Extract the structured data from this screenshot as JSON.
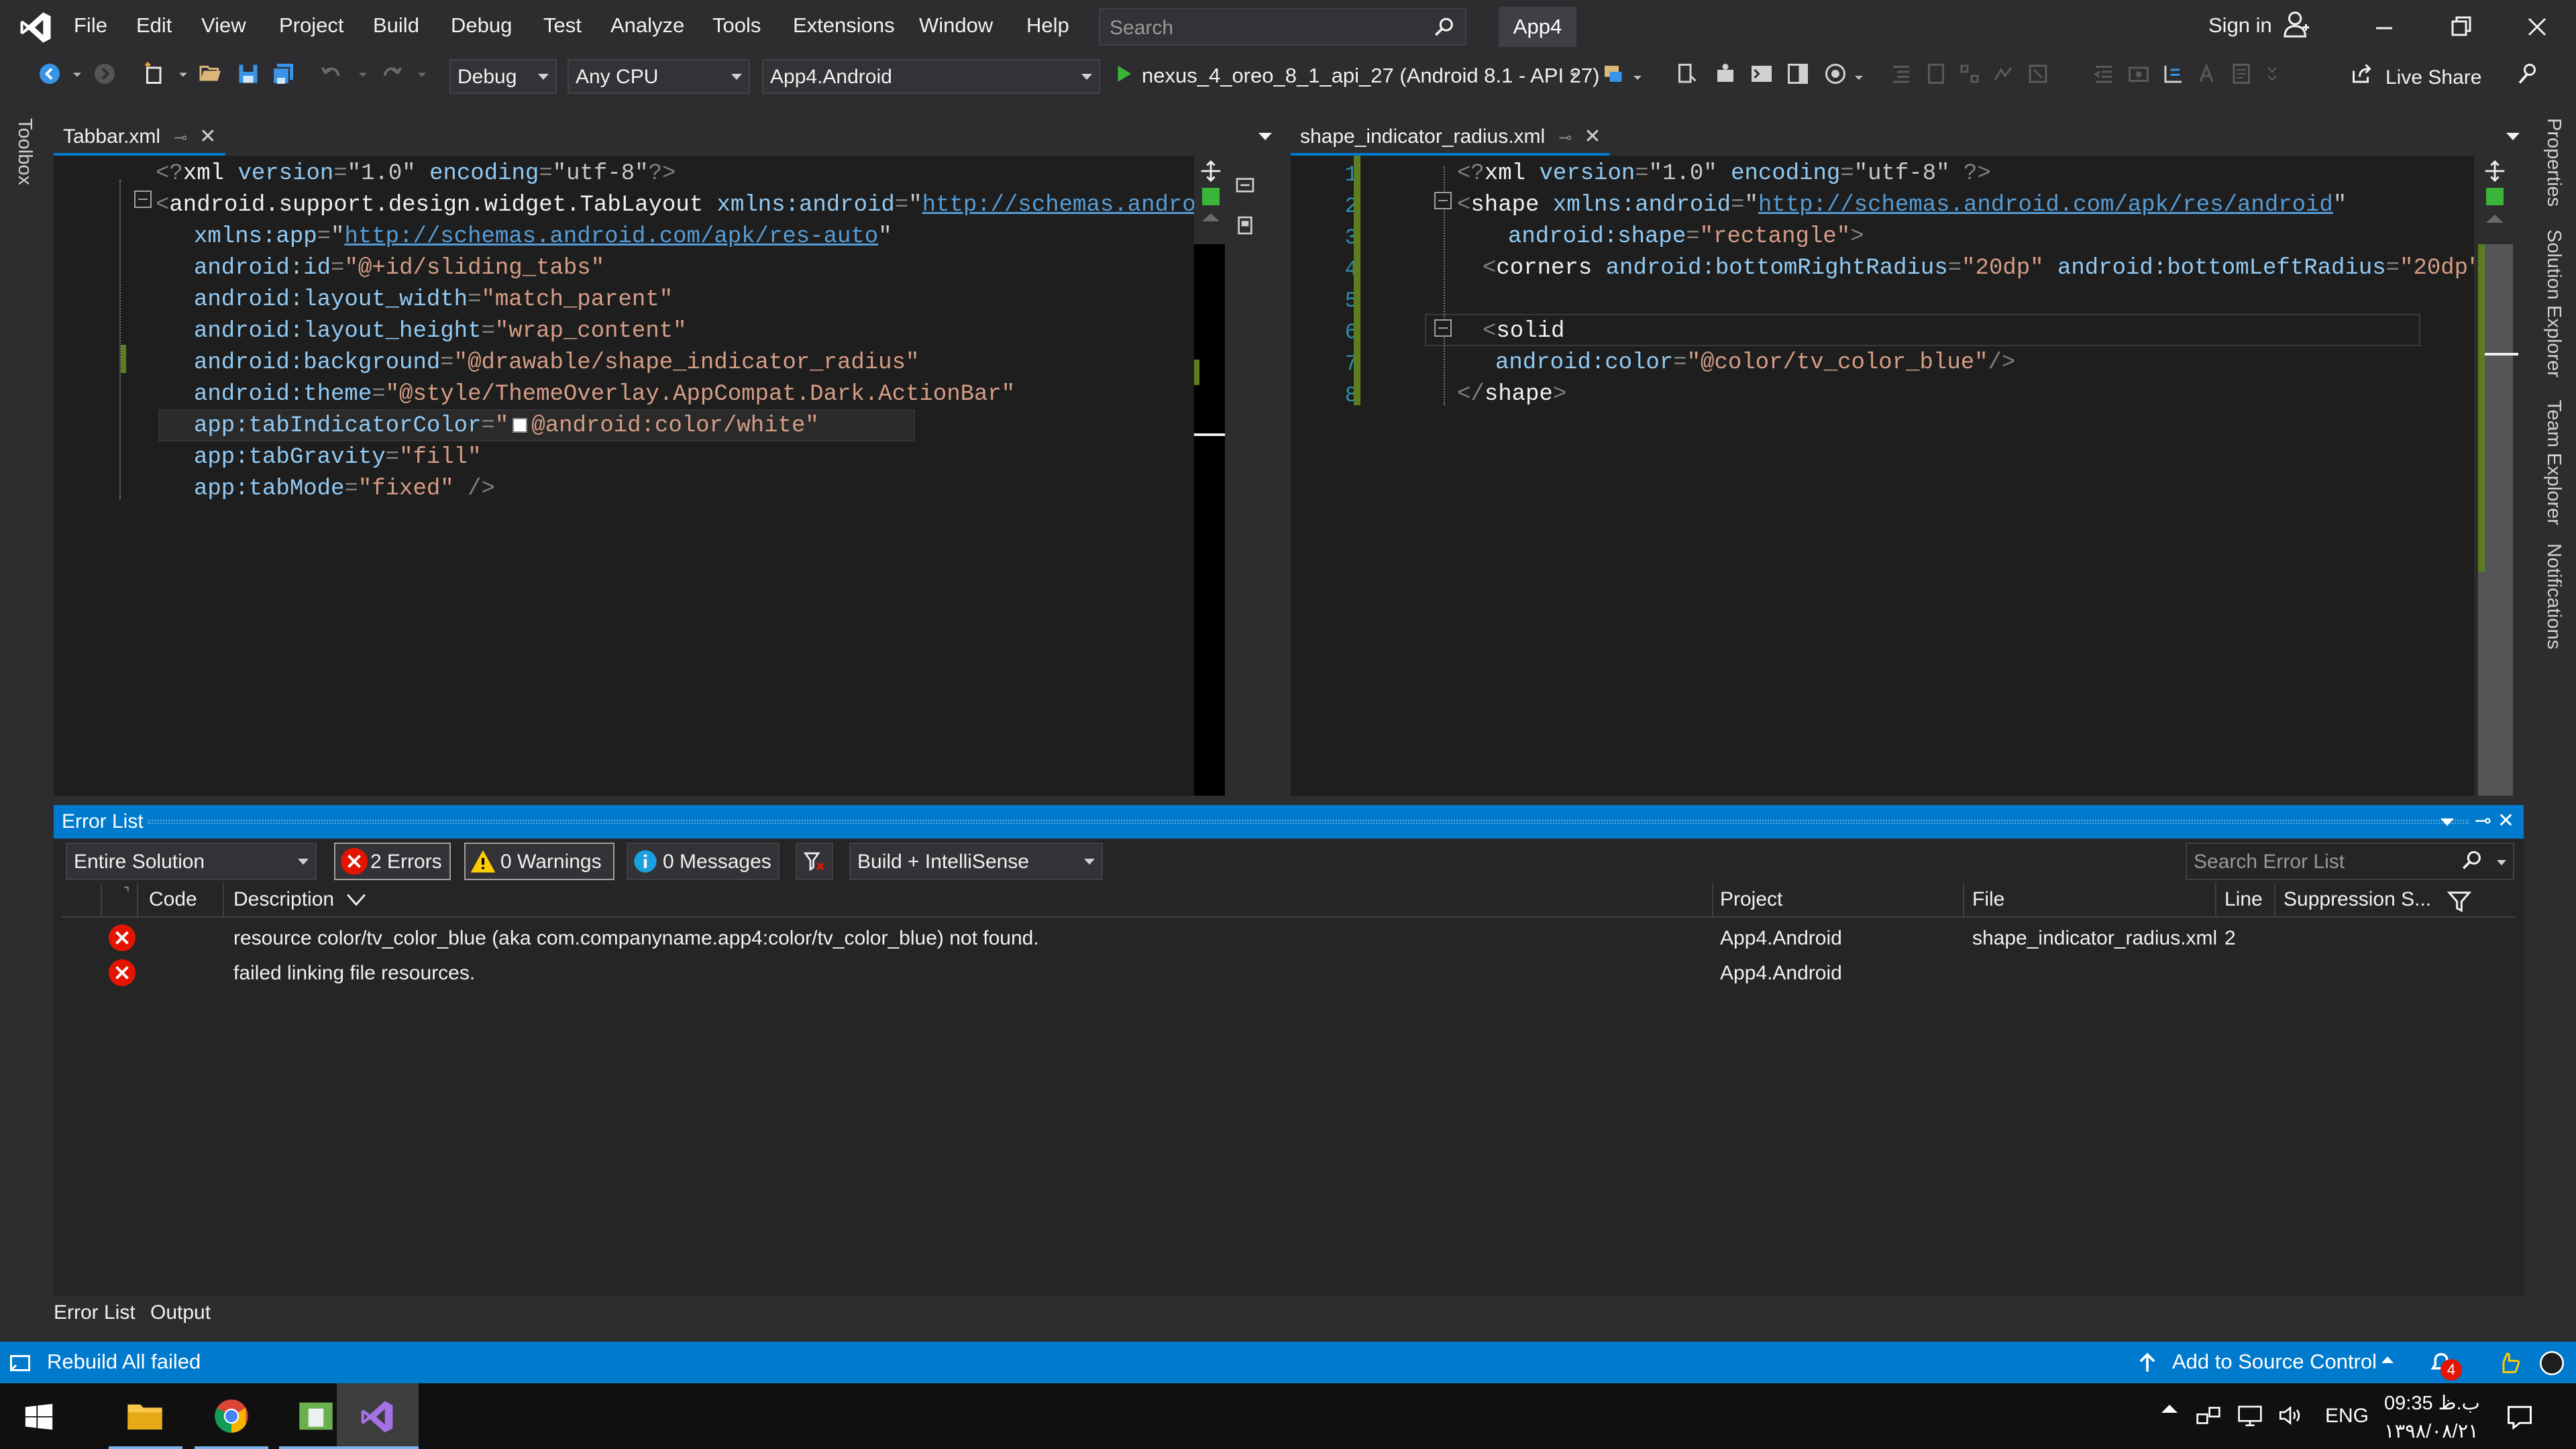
{
  "menu": {
    "items": [
      "File",
      "Edit",
      "View",
      "Project",
      "Build",
      "Debug",
      "Test",
      "Analyze",
      "Tools",
      "Extensions",
      "Window",
      "Help"
    ],
    "search_placeholder": "Search",
    "solution_name": "App4",
    "sign_in": "Sign in"
  },
  "toolbar": {
    "configuration": "Debug",
    "platform": "Any CPU",
    "startup_project": "App4.Android",
    "run_target": "nexus_4_oreo_8_1_api_27 (Android 8.1 - API 27)",
    "live_share": "Live Share"
  },
  "side_rails": {
    "left": [
      "Toolbox"
    ],
    "right": [
      "Properties",
      "Solution Explorer",
      "Team Explorer",
      "Notifications"
    ]
  },
  "left_editor": {
    "tab": "Tabbar.xml",
    "lines": [
      {
        "indent": 0,
        "parts": [
          [
            "punc",
            "<?"
          ],
          [
            "tag",
            "xml "
          ],
          [
            "attr",
            "version"
          ],
          [
            "punc",
            "="
          ],
          [
            "str",
            "\"1.0\" "
          ],
          [
            "attr",
            "encoding"
          ],
          [
            "punc",
            "="
          ],
          [
            "str",
            "\"utf-8\""
          ],
          [
            "punc",
            "?>"
          ]
        ]
      },
      {
        "indent": 0,
        "parts": [
          [
            "punc",
            "<"
          ],
          [
            "tag",
            "android.support.design.widget.TabLayout "
          ],
          [
            "attr",
            "xmlns:android"
          ],
          [
            "punc",
            "="
          ],
          [
            "str",
            "\""
          ],
          [
            "link",
            "http://schemas.android."
          ]
        ]
      },
      {
        "indent": 1,
        "parts": [
          [
            "attr",
            "xmlns:app"
          ],
          [
            "punc",
            "="
          ],
          [
            "str",
            "\""
          ],
          [
            "link",
            "http://schemas.android.com/apk/res-auto"
          ],
          [
            "str",
            "\""
          ]
        ]
      },
      {
        "indent": 1,
        "parts": [
          [
            "attr",
            "android:id"
          ],
          [
            "punc",
            "="
          ],
          [
            "val",
            "\"@+id/sliding_tabs\""
          ]
        ]
      },
      {
        "indent": 1,
        "parts": [
          [
            "attr",
            "android:layout_width"
          ],
          [
            "punc",
            "="
          ],
          [
            "val",
            "\"match_parent\""
          ]
        ]
      },
      {
        "indent": 1,
        "parts": [
          [
            "attr",
            "android:layout_height"
          ],
          [
            "punc",
            "="
          ],
          [
            "val",
            "\"wrap_content\""
          ]
        ]
      },
      {
        "indent": 1,
        "parts": [
          [
            "attr",
            "android:background"
          ],
          [
            "punc",
            "="
          ],
          [
            "val",
            "\"@drawable/shape_indicator_radius\""
          ]
        ]
      },
      {
        "indent": 1,
        "parts": [
          [
            "attr",
            "android:theme"
          ],
          [
            "punc",
            "="
          ],
          [
            "val",
            "\"@style/ThemeOverlay.AppCompat.Dark.ActionBar\""
          ]
        ]
      },
      {
        "indent": 1,
        "parts": [
          [
            "attr",
            "app:tabIndicatorColor"
          ],
          [
            "punc",
            "="
          ],
          [
            "val",
            "\""
          ],
          [
            "swatch",
            ""
          ],
          [
            "val",
            "@android:color/white\""
          ]
        ]
      },
      {
        "indent": 1,
        "parts": [
          [
            "attr",
            "app:tabGravity"
          ],
          [
            "punc",
            "="
          ],
          [
            "val",
            "\"fill\""
          ]
        ]
      },
      {
        "indent": 1,
        "parts": [
          [
            "attr",
            "app:tabMode"
          ],
          [
            "punc",
            "="
          ],
          [
            "val",
            "\"fixed\" "
          ],
          [
            "punc",
            "/>"
          ]
        ]
      }
    ]
  },
  "right_editor": {
    "tab": "shape_indicator_radius.xml",
    "line_numbers": [
      "1",
      "2",
      "3",
      "4",
      "5",
      "6",
      "7",
      "8"
    ],
    "lines": [
      {
        "indent": 0,
        "parts": [
          [
            "punc",
            "<?"
          ],
          [
            "tag",
            "xml "
          ],
          [
            "attr",
            "version"
          ],
          [
            "punc",
            "="
          ],
          [
            "str",
            "\"1.0\" "
          ],
          [
            "attr",
            "encoding"
          ],
          [
            "punc",
            "="
          ],
          [
            "str",
            "\"utf-8\" "
          ],
          [
            "punc",
            "?>"
          ]
        ]
      },
      {
        "indent": 0,
        "parts": [
          [
            "punc",
            "<"
          ],
          [
            "tag",
            "shape "
          ],
          [
            "attr",
            "xmlns:android"
          ],
          [
            "punc",
            "="
          ],
          [
            "str",
            "\""
          ],
          [
            "link",
            "http://schemas.android.com/apk/res/android"
          ],
          [
            "str",
            "\""
          ]
        ]
      },
      {
        "indent": 2,
        "parts": [
          [
            "attr",
            "android:shape"
          ],
          [
            "punc",
            "="
          ],
          [
            "val",
            "\"rectangle\""
          ],
          [
            "punc",
            ">"
          ]
        ]
      },
      {
        "indent": 1,
        "parts": [
          [
            "punc",
            "<"
          ],
          [
            "tag",
            "corners "
          ],
          [
            "attr",
            "android:bottomRightRadius"
          ],
          [
            "punc",
            "="
          ],
          [
            "val",
            "\"20dp\" "
          ],
          [
            "attr",
            "android:bottomLeftRadius"
          ],
          [
            "punc",
            "="
          ],
          [
            "val",
            "\"20dp\""
          ],
          [
            "punc",
            "/>"
          ]
        ]
      },
      {
        "indent": 0,
        "parts": []
      },
      {
        "indent": 1,
        "parts": [
          [
            "punc",
            "<"
          ],
          [
            "tag",
            "solid"
          ]
        ]
      },
      {
        "indent": 1.5,
        "parts": [
          [
            "attr",
            "android:color"
          ],
          [
            "punc",
            "="
          ],
          [
            "val",
            "\"@color/tv_color_blue\""
          ],
          [
            "punc",
            "/>"
          ]
        ]
      },
      {
        "indent": 0,
        "parts": [
          [
            "punc",
            "</"
          ],
          [
            "tag",
            "shape"
          ],
          [
            "punc",
            ">"
          ]
        ]
      }
    ]
  },
  "error_list": {
    "title": "Error List",
    "scope": "Entire Solution",
    "errors_btn": "2 Errors",
    "warnings_btn": "0 Warnings",
    "messages_btn": "0 Messages",
    "build_filter": "Build + IntelliSense",
    "search_placeholder": "Search Error List",
    "columns": {
      "code": "Code",
      "description": "Description",
      "project": "Project",
      "file": "File",
      "line": "Line",
      "suppression": "Suppression S..."
    },
    "rows": [
      {
        "description": "resource color/tv_color_blue (aka com.companyname.app4:color/tv_color_blue) not found.",
        "project": "App4.Android",
        "file": "shape_indicator_radius.xml",
        "line": "2"
      },
      {
        "description": "failed linking file resources.",
        "project": "App4.Android",
        "file": "",
        "line": ""
      }
    ]
  },
  "bottom_tabs": [
    "Error List",
    "Output"
  ],
  "status": {
    "message": "Rebuild All failed",
    "source_control": "Add to Source Control",
    "notification_count": "4"
  },
  "taskbar": {
    "lang": "ENG",
    "time": "09:35 ب.ظ",
    "date": "۱۳۹۸/۰۸/۲۱"
  },
  "colors": {
    "accent": "#007acc",
    "error": "#e51400",
    "warning": "#ffcc00",
    "editor_bg": "#1e1e1e",
    "chrome_bg": "#2d2d30"
  }
}
